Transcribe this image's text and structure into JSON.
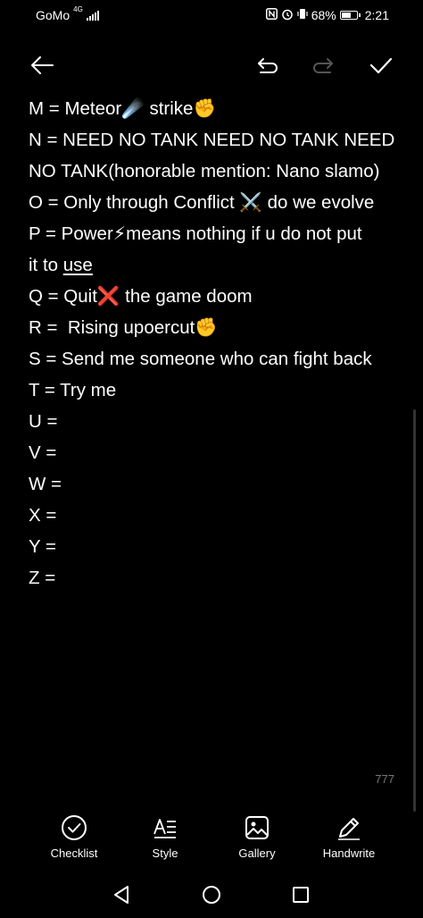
{
  "status": {
    "carrier": "GoMo",
    "network": "4G",
    "battery": "68%",
    "battery_level": 0.68,
    "time": "2:21"
  },
  "note": {
    "lines": [
      {
        "text": "M = Meteor☄️ strike✊"
      },
      {
        "text": "N = NEED NO TANK NEED NO TANK NEED"
      },
      {
        "text": "NO TANK(honorable mention: Nano slamo)"
      },
      {
        "text": "O = Only through Conflict ⚔️ do we evolve"
      },
      {
        "text": "P = Power⚡means nothing if u do not put"
      },
      {
        "text": "it to ",
        "underlined": "use"
      },
      {
        "text": "Q = Quit❌ the game doom"
      },
      {
        "text": "R =  Rising upoercut✊"
      },
      {
        "text": "S = Send me someone who can fight back"
      },
      {
        "text": "T = Try me"
      },
      {
        "text": "U ="
      },
      {
        "text": "V ="
      },
      {
        "text": "W ="
      },
      {
        "text": "X ="
      },
      {
        "text": "Y ="
      },
      {
        "text": "Z ="
      }
    ],
    "char_count": "777"
  },
  "bottom_tools": [
    {
      "label": "Checklist",
      "icon": "checklist-icon"
    },
    {
      "label": "Style",
      "icon": "style-icon"
    },
    {
      "label": "Gallery",
      "icon": "gallery-icon"
    },
    {
      "label": "Handwrite",
      "icon": "handwrite-icon"
    }
  ]
}
